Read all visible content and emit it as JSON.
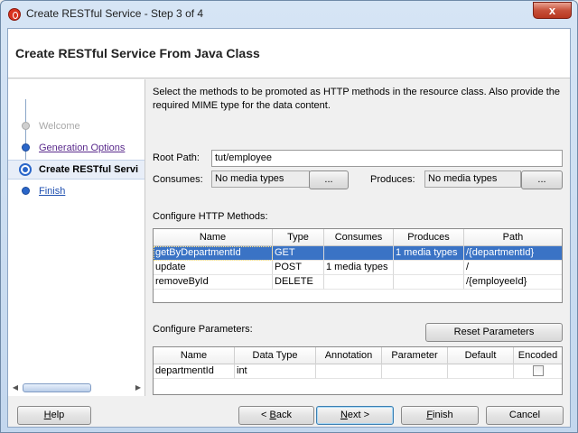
{
  "window": {
    "title": "Create RESTful Service - Step 3 of 4",
    "close_label": "x"
  },
  "header": {
    "title": "Create RESTful Service From Java Class"
  },
  "sidebar": {
    "steps": [
      {
        "label": "Welcome",
        "state": "disabled"
      },
      {
        "label": "Generation Options",
        "state": "visited"
      },
      {
        "label": "Create RESTful Servi",
        "state": "current"
      },
      {
        "label": "Finish",
        "state": "link"
      }
    ]
  },
  "main": {
    "description": "Select the methods to be promoted as HTTP methods in the resource class. Also provide the required MIME type for the data content.",
    "root_path_label": "Root Path:",
    "root_path_value": "tut/employee",
    "consumes_label": "Consumes:",
    "consumes_value": "No media types",
    "consumes_button": "...",
    "produces_label": "Produces:",
    "produces_value": "No media types",
    "produces_button": "...",
    "methods_label": "Configure HTTP Methods:",
    "methods_table": {
      "columns": [
        "Name",
        "Type",
        "Consumes",
        "Produces",
        "Path"
      ],
      "rows": [
        [
          "getByDepartmentId",
          "GET",
          "",
          "1 media types",
          "/{departmentId}"
        ],
        [
          "update",
          "POST",
          "1 media types",
          "",
          "/"
        ],
        [
          "removeById",
          "DELETE",
          "",
          "",
          "/{employeeId}"
        ]
      ],
      "selected_row": 0
    },
    "params_label": "Configure Parameters:",
    "reset_button": "Reset Parameters",
    "params_table": {
      "columns": [
        "Name",
        "Data Type",
        "Annotation",
        "Parameter",
        "Default",
        "Encoded"
      ],
      "rows": [
        [
          "departmentId",
          "int",
          "",
          "",
          "",
          ""
        ]
      ],
      "encoded_checked": false
    }
  },
  "footer": {
    "help": "Help",
    "back": "< Back",
    "next": "Next >",
    "finish": "Finish",
    "cancel": "Cancel"
  },
  "colors": {
    "selection": "#3a73c5",
    "step_dot": "#2a66c9",
    "visited_link": "#5a2a8c"
  }
}
